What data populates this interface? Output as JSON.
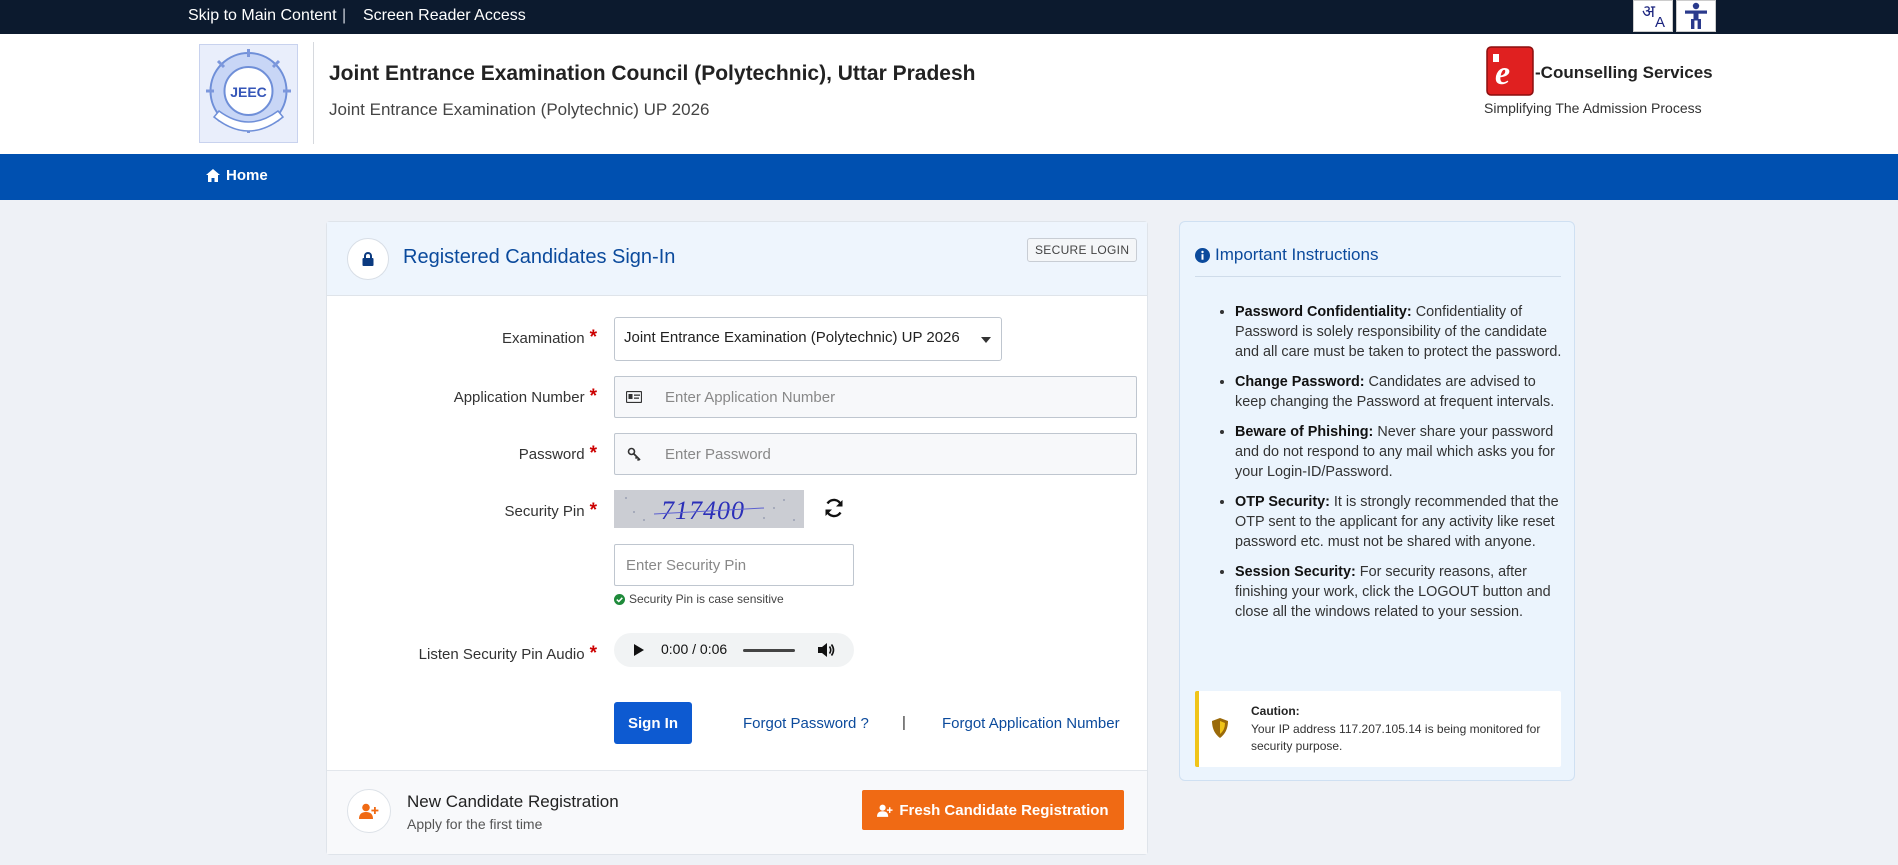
{
  "topbar": {
    "skip_label": "Skip to Main Content",
    "separator": "|",
    "screen_reader_label": "Screen Reader Access",
    "lang_toggle_hi": "अ",
    "lang_toggle_en": "A"
  },
  "header": {
    "org_title": "Joint Entrance Examination Council (Polytechnic), Uttar Pradesh",
    "org_subtitle": "Joint Entrance Examination (Polytechnic) UP 2026",
    "logo_text": "JEEC",
    "brand_name": "-Counselling Services",
    "brand_tagline": "Simplifying The Admission Process"
  },
  "nav": {
    "home_label": "Home"
  },
  "signin": {
    "title": "Registered Candidates Sign-In",
    "secure_badge": "SECURE LOGIN",
    "examination_label": "Examination",
    "examination_value": "Joint Entrance Examination (Polytechnic) UP 2026",
    "application_label": "Application Number",
    "application_placeholder": "Enter Application Number",
    "password_label": "Password",
    "password_placeholder": "Enter Password",
    "security_pin_label": "Security Pin",
    "captcha_text": "717400",
    "pin_placeholder": "Enter Security Pin",
    "pin_note": "Security Pin is case sensitive",
    "audio_label": "Listen Security Pin Audio",
    "audio_time": "0:00 / 0:06",
    "required_mark": "*",
    "signin_button": "Sign In",
    "forgot_password": "Forgot Password ?",
    "link_separator": "|",
    "forgot_application": "Forgot Application Number"
  },
  "registration": {
    "title": "New Candidate Registration",
    "subtitle": "Apply for the first time",
    "button": "Fresh Candidate Registration"
  },
  "instructions": {
    "title": "Important Instructions",
    "items": [
      {
        "heading": "Password Confidentiality:",
        "text": " Confidentiality of Password is solely responsibility of the candidate and all care must be taken to protect the password."
      },
      {
        "heading": "Change Password:",
        "text": " Candidates are advised to keep changing the Password at frequent intervals."
      },
      {
        "heading": "Beware of Phishing:",
        "text": " Never share your password and do not respond to any mail which asks you for your Login-ID/Password."
      },
      {
        "heading": "OTP Security:",
        "text": " It is strongly recommended that the OTP sent to the applicant for any activity like reset password etc. must not be shared with anyone."
      },
      {
        "heading": "Session Security:",
        "text": " For security reasons, after finishing your work, click the LOGOUT button and close all the windows related to your session."
      }
    ],
    "caution_title": "Caution:",
    "caution_text": "Your IP address 117.207.105.14 is being monitored for security purpose."
  },
  "colors": {
    "topbar": "#0c1a2e",
    "nav": "#0050b0",
    "primary_button": "#0d5ad1",
    "accent_orange": "#f06a14",
    "link": "#0b4a9c",
    "required": "#cc0000"
  }
}
